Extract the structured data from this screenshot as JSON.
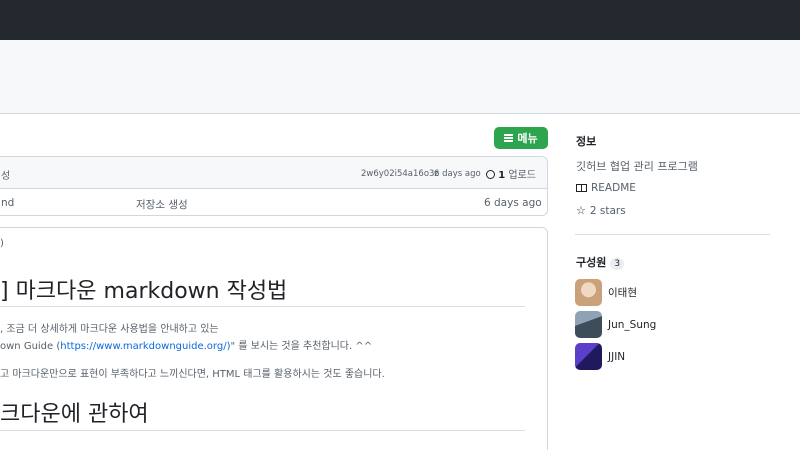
{
  "header": {},
  "toolbar": {
    "menu_label": "메뉴"
  },
  "file_list": {
    "header_left": "성",
    "commit_hash": "2w6y02i54a16o3z",
    "commit_time": "6 days ago",
    "upload_count": "1",
    "upload_label": "업로드",
    "rows": [
      {
        "name": "nd",
        "message": "저장소 생성",
        "time": "6 days ago"
      }
    ]
  },
  "readme": {
    "paren_fragment": ")",
    "h1": "] 마크다운 markdown 작성법",
    "p1_line1": ", 조금 더 상세하게 마크다운 사용법을 안내하고 있는",
    "p1_line2_pre": "own Guide (",
    "p1_link": "https://www.markdownguide.org/)",
    "p1_line2_post": "\" 를 보시는 것을 추천합니다. ^^",
    "p2": "고 마크다운만으로 표현이 부족하다고 느끼신다면, HTML 태그를 활용하시는 것도 좋습니다.",
    "h2": "크다운에 관하여"
  },
  "sidebar": {
    "about_title": "정보",
    "description": "깃허브 협업 관리 프로그램",
    "readme_label": "README",
    "stars_label": "2 stars",
    "members_title": "구성원",
    "members_count": "3",
    "members": [
      {
        "name": "이태현",
        "color": "#c9a27a"
      },
      {
        "name": "Jun_Sung",
        "color": "#5b6b7a"
      },
      {
        "name": "JJIN",
        "color": "#3b2f8f"
      }
    ]
  },
  "colors": {
    "accent": "#2da44e",
    "link": "#0969da",
    "topbar": "#24292f"
  }
}
